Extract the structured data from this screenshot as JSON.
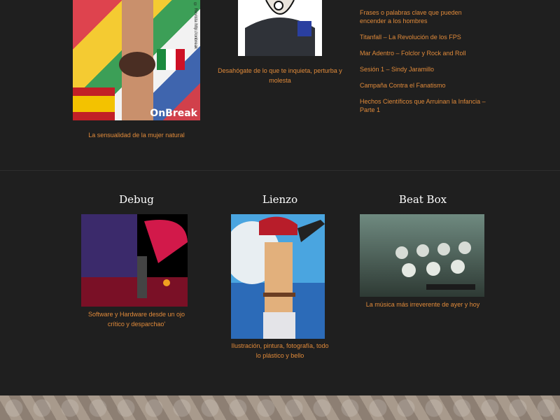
{
  "top_captions": {
    "left": "La sensualidad de la mujer natural",
    "middle": "Desahógate de lo que te inquieta, perturba y molesta"
  },
  "left_image_brand": "OnBreak",
  "left_image_credit": "© Revista http://onbreak",
  "recent_links": [
    "Frases o palabras clave que pueden encender a los hombres",
    "Titanfall – La Revolución de los FPS",
    "Mar Adentro – Folclor y Rock and Roll",
    "Sesión 1 – Sindy Jaramillo",
    "Campaña Contra el Fanatismo",
    "Hechos Científicos que Arruinan la Infancia – Parte 1"
  ],
  "sections": [
    {
      "title": "Debug",
      "caption": "Software y Hardware desde un ojo crítico y desparchao'"
    },
    {
      "title": "Lienzo",
      "caption": "Ilustración, pintura, fotografía, todo lo plástico y bello"
    },
    {
      "title": "Beat Box",
      "caption": "La música más irreverente de ayer y hoy"
    }
  ]
}
